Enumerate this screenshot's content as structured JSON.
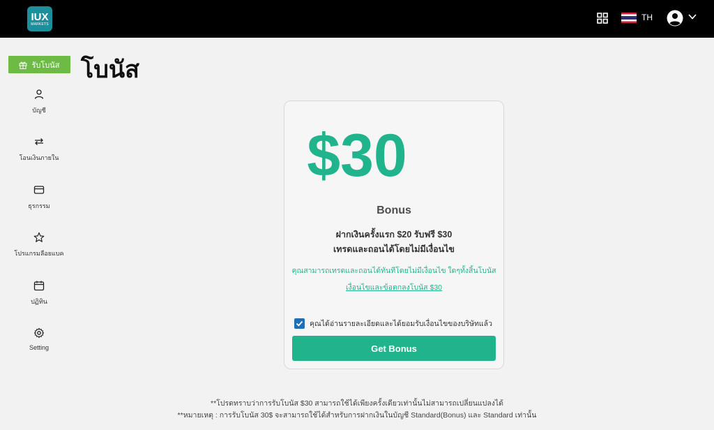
{
  "header": {
    "logo_main": "IUX",
    "logo_sub": "MARKETS",
    "apps_icon": "grid-icon",
    "flag_icon": "thailand-flag-icon",
    "language": "TH",
    "avatar_icon": "user-avatar-icon",
    "dropdown_icon": "chevron-down-icon"
  },
  "sidebar": {
    "bonus_button": {
      "label": "รับโบนัส",
      "icon": "gift-icon"
    },
    "items": [
      {
        "label": "บัญชี",
        "icon": "user-icon"
      },
      {
        "label": "โอนเงินภายใน",
        "icon": "transfer-icon"
      },
      {
        "label": "ธุรกรรม",
        "icon": "credit-card-icon"
      },
      {
        "label": "โปรแกรมลือยแบค",
        "icon": "star-icon"
      },
      {
        "label": "ปฏิทิน",
        "icon": "calendar-icon"
      },
      {
        "label": "Setting",
        "icon": "gear-icon"
      }
    ]
  },
  "main": {
    "title": "โบนัส",
    "card": {
      "amount": "$30",
      "bonus_label": "Bonus",
      "desc_line1": "ฝากเงินครั้งแรก $20 รับฟรี $30",
      "desc_line2": "เทรดและถอนได้โดยไม่มีเงื่อนไข",
      "note": "คุณสามารถเทรดและถอนได้ทันทีโดยไม่มีเงื่อนไข ใดๆทั้งสิ้นโบนัส",
      "terms_link": "เงื่อนไขและข้อตกลงโบนัส $30",
      "agree_text": "คุณได้อ่านรายละเอียดและได้ยอมรับเงื่อนไขของบริษัทแล้ว",
      "agree_checked": true,
      "button_label": "Get Bonus"
    },
    "footer_line1": "**โปรดทราบว่าการรับโบนัส $30 สามารถใช้ได้เพียงครั้งเดียวเท่านั้นไม่สามารถเปลี่ยนแปลงได้",
    "footer_line2": "**หมายเหตุ : การรับโบนัส 30$ จะสามารถใช้ได้สำหรับการฝากเงินในบัญชี Standard(Bonus) และ Standard เท่านั้น"
  },
  "colors": {
    "accent": "#21b48c",
    "bonus_pill": "#6dbb45",
    "topbar": "#000000",
    "checkbox": "#1f6fb5"
  }
}
